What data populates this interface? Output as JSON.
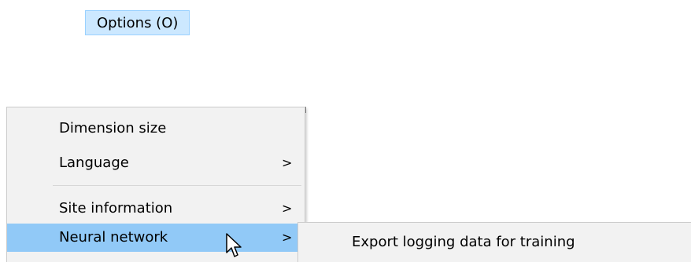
{
  "menubar": {
    "options_label": "Options (O)"
  },
  "options_menu": {
    "items": [
      {
        "label": "Dimension size",
        "has_submenu": false
      },
      {
        "label": "Language",
        "has_submenu": true,
        "arrow": ">"
      },
      {
        "label": "Site information",
        "has_submenu": true,
        "arrow": ">"
      },
      {
        "label": "Neural network",
        "has_submenu": true,
        "arrow": ">",
        "highlighted": true
      }
    ]
  },
  "neural_network_submenu": {
    "items": [
      {
        "label": "Export logging data for training"
      }
    ]
  },
  "colors": {
    "menu_background": "#f2f2f2",
    "highlight": "#91c9f7",
    "menubar_highlight": "#cce8ff"
  },
  "cursor": "arrow-pointer-icon"
}
